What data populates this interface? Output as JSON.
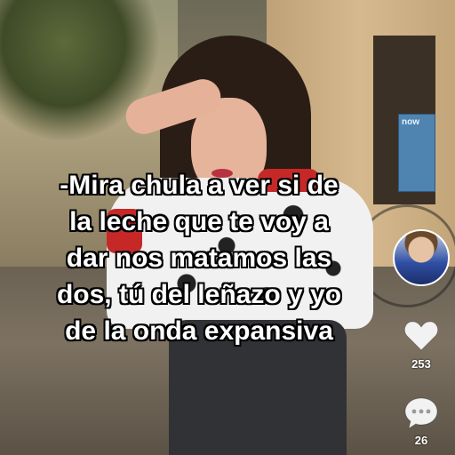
{
  "caption": {
    "lines": [
      "-Mira chula a ver si de",
      "la leche que te voy a",
      "dar nos matamos las",
      "dos, tú del leñazo y yo",
      "de la onda expansiva"
    ]
  },
  "background_sign": {
    "text": "now"
  },
  "actions": {
    "like_count": "253",
    "comment_count": "26"
  },
  "icons": {
    "like": "heart-icon",
    "comment": "comment-bubble-icon",
    "avatar": "creator-avatar"
  },
  "colors": {
    "caption_text": "#ffffff",
    "caption_outline": "#000000",
    "icon_fill": "#f2f2f2"
  }
}
